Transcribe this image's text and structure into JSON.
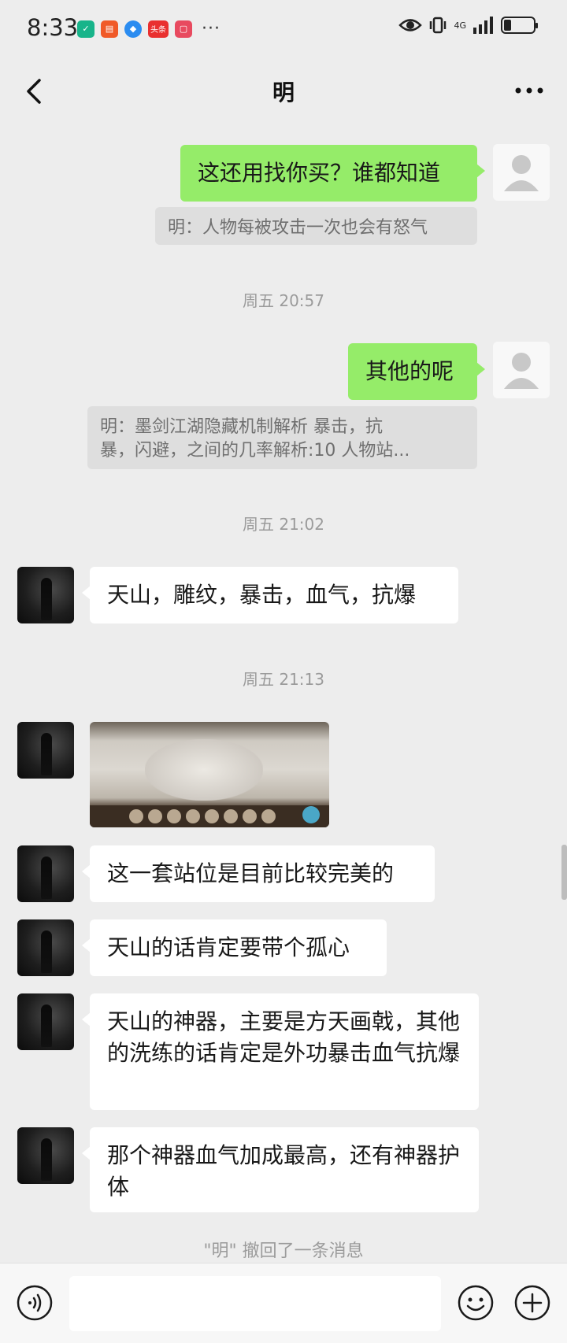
{
  "status_bar": {
    "time": "8:33",
    "network": "4G",
    "icons": [
      "shield-app-icon",
      "app-icon",
      "security-icon",
      "toutiao-icon",
      "app-icon",
      "more-notifications-icon",
      "eye-icon",
      "vibrate-icon",
      "signal-icon",
      "battery-icon"
    ],
    "app_badge_text": "头条",
    "more": "···",
    "battery_level": 0.25
  },
  "header": {
    "title": "明",
    "back_icon": "chevron-left-icon",
    "more_icon": "ellipsis-icon"
  },
  "messages": [
    {
      "kind": "text",
      "sender": "self",
      "text": "这还用找你买？谁都知道"
    },
    {
      "kind": "quote",
      "text": "明：人物每被攻击一次也会有怒气"
    },
    {
      "kind": "timestamp",
      "text": "周五 20:57"
    },
    {
      "kind": "text",
      "sender": "self",
      "text": "其他的呢"
    },
    {
      "kind": "quote",
      "line1": "明：墨剑江湖隐藏机制解析 暴击，抗",
      "line2": "暴，闪避，之间的几率解析:10 人物站..."
    },
    {
      "kind": "timestamp",
      "text": "周五 21:02"
    },
    {
      "kind": "text",
      "sender": "other",
      "text": "天山，雕纹，暴击，血气，抗爆"
    },
    {
      "kind": "timestamp",
      "text": "周五 21:13"
    },
    {
      "kind": "image",
      "sender": "other",
      "alt": "game-screenshot"
    },
    {
      "kind": "text",
      "sender": "other",
      "text": "这一套站位是目前比较完美的"
    },
    {
      "kind": "text",
      "sender": "other",
      "text": "天山的话肯定要带个孤心"
    },
    {
      "kind": "text",
      "sender": "other",
      "text": "天山的神器，主要是方天画戟，其他的洗练的话肯定是外功暴击血气抗爆"
    },
    {
      "kind": "text",
      "sender": "other",
      "text": "那个神器血气加成最高，还有神器护体"
    },
    {
      "kind": "notice",
      "text": "\"明\" 撤回了一条消息"
    }
  ],
  "input_bar": {
    "voice_icon": "voice-icon",
    "emoji_icon": "emoji-icon",
    "plus_icon": "plus-icon",
    "value": "",
    "placeholder": ""
  },
  "colors": {
    "background": "#ededed",
    "self_bubble": "#95ec69",
    "other_bubble": "#ffffff",
    "quote_bg": "#dedede",
    "timestamp": "#9b9b9b"
  }
}
